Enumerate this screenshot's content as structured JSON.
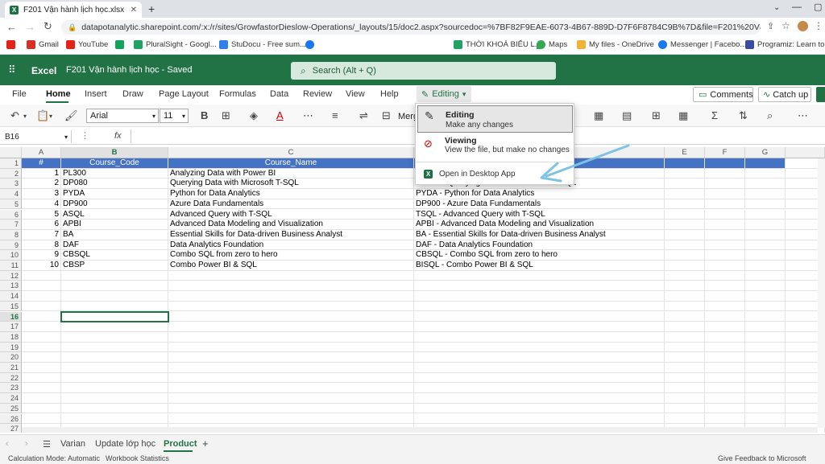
{
  "browser": {
    "tab_title": "F201 Vận hành lịch học.xlsx",
    "url": "datapotanalytic.sharepoint.com/:x:/r/sites/GrowfastorDieslow-Operations/_layouts/15/doc2.aspx?sourcedoc=%7BF82F9EAE-6073-4B67-889D-D7F6F8784C9B%7D&file=F201%20Vận%20hành...",
    "bookmarks": [
      "Gmail",
      "YouTube",
      "PluralSight - Googl...",
      "StuDocu - Free sum...",
      "THỜI KHOÁ BIỂU L...",
      "Maps",
      "My files - OneDrive",
      "Messenger | Facebo...",
      "Programiz: Learn to..."
    ]
  },
  "app": {
    "name": "Excel",
    "file_title": "F201 Vận hành lịch học - Saved",
    "search_placeholder": "Search (Alt + Q)"
  },
  "ribbon": {
    "tabs": [
      "File",
      "Home",
      "Insert",
      "Draw",
      "Page Layout",
      "Formulas",
      "Data",
      "Review",
      "View",
      "Help"
    ],
    "active_tab": "Home",
    "editing_label": "Editing",
    "comments_label": "Comments",
    "catchup_label": "Catch up",
    "font_name": "Arial",
    "font_size": "11",
    "merge_label": "Merg"
  },
  "formula_bar": {
    "name_box": "B16",
    "fx": "fx"
  },
  "grid": {
    "columns": [
      "A",
      "B",
      "C",
      "D",
      "E",
      "F",
      "G"
    ],
    "header_row": [
      "#",
      "Course_Code",
      "Course_Name",
      ""
    ],
    "rows": [
      [
        "1",
        "PL300",
        "Analyzing Data with Power BI",
        "PL300 - Analyzing Data with Power BI"
      ],
      [
        "2",
        "DP080",
        "Querying Data with Microsoft T-SQL",
        "DP080 - Querying Data with Microsoft T-SQL"
      ],
      [
        "3",
        "PYDA",
        "Python for Data Analytics",
        "PYDA - Python for Data Analytics"
      ],
      [
        "4",
        "DP900",
        "Azure Data Fundamentals",
        "DP900 - Azure Data Fundamentals"
      ],
      [
        "5",
        "ASQL",
        "Advanced Query with T-SQL",
        "TSQL - Advanced Query with T-SQL"
      ],
      [
        "6",
        "APBI",
        "Advanced Data Modeling and Visualization",
        "APBI - Advanced Data Modeling and Visualization"
      ],
      [
        "7",
        "BA",
        "Essential Skills for Data-driven Business Analyst",
        "BA  - Essential Skills for Data-driven Business Analyst"
      ],
      [
        "8",
        "DAF",
        "Data Analytics Foundation",
        "DAF - Data Analytics Foundation"
      ],
      [
        "9",
        "CBSQL",
        "Combo SQL from zero to hero",
        "CBSQL - Combo SQL from zero to hero"
      ],
      [
        "10",
        "CBSP",
        "Combo Power BI & SQL",
        "BISQL - Combo Power BI & SQL"
      ]
    ],
    "row_numbers": [
      "1",
      "2",
      "3",
      "4",
      "5",
      "6",
      "7",
      "8",
      "9",
      "10",
      "11",
      "12",
      "13",
      "14",
      "15",
      "16",
      "17",
      "18",
      "19",
      "20",
      "21",
      "22",
      "23",
      "24",
      "25",
      "26",
      "27"
    ],
    "selected_cell": "B16"
  },
  "editing_menu": {
    "editing_title": "Editing",
    "editing_desc": "Make any changes",
    "viewing_title": "Viewing",
    "viewing_desc": "View the file, but make no changes",
    "open_desktop": "Open in Desktop App"
  },
  "sheets": {
    "tabs": [
      "Varian",
      "Update lớp học",
      "Product"
    ],
    "active": "Product"
  },
  "status": {
    "calc_mode": "Calculation Mode: Automatic",
    "workbook_stats": "Workbook Statistics",
    "feedback": "Give Feedback to Microsoft"
  },
  "colors": {
    "excel_green": "#217346",
    "header_blue": "#4472c4",
    "arrow": "#7ec3e6"
  }
}
